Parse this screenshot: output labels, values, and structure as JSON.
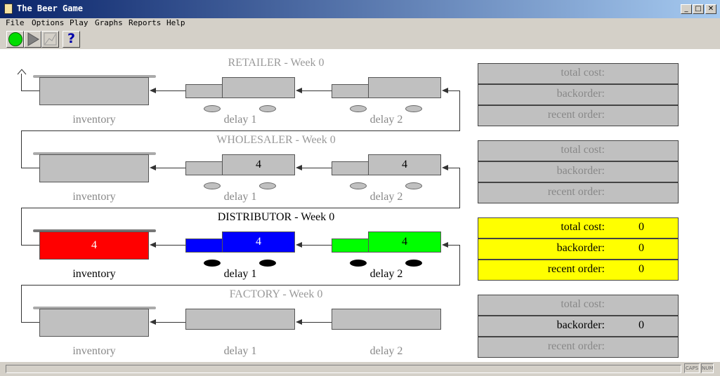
{
  "window": {
    "title": "The Beer Game",
    "minimize": "_",
    "maximize": "□",
    "close": "✕"
  },
  "menu": [
    "File",
    "Options",
    "Play",
    "Graphs",
    "Reports",
    "Help"
  ],
  "toolbar": {
    "help_glyph": "?"
  },
  "labels": {
    "inventory": "inventory",
    "delay1": "delay 1",
    "delay2": "delay 2"
  },
  "stages": [
    {
      "title": "RETAILER - Week 0",
      "inventory": "",
      "d1": "",
      "d2": ""
    },
    {
      "title": "WHOLESALER - Week 0",
      "inventory": "",
      "d1": "4",
      "d2": "4"
    },
    {
      "title": "DISTRIBUTOR - Week 0",
      "inventory": "4",
      "d1": "4",
      "d2": "4"
    },
    {
      "title": "FACTORY - Week 0",
      "inventory": "",
      "d1": "",
      "d2": ""
    }
  ],
  "stats": [
    [
      {
        "label": "total cost:",
        "value": ""
      },
      {
        "label": "backorder:",
        "value": ""
      },
      {
        "label": "recent order:",
        "value": ""
      }
    ],
    [
      {
        "label": "total cost:",
        "value": ""
      },
      {
        "label": "backorder:",
        "value": ""
      },
      {
        "label": "recent order:",
        "value": ""
      }
    ],
    [
      {
        "label": "total cost:",
        "value": "0"
      },
      {
        "label": "backorder:",
        "value": "0"
      },
      {
        "label": "recent order:",
        "value": "0"
      }
    ],
    [
      {
        "label": "total cost:",
        "value": ""
      },
      {
        "label": "backorder:",
        "value": "0"
      },
      {
        "label": "recent order:",
        "value": ""
      }
    ]
  ],
  "status": {
    "caps": "CAPS",
    "num": "NUM"
  },
  "colors": {
    "inventory_active": "#ff0000",
    "delay1_active": "#0000ff",
    "delay2_active": "#00ff00",
    "stats_active": "#ffff00"
  }
}
